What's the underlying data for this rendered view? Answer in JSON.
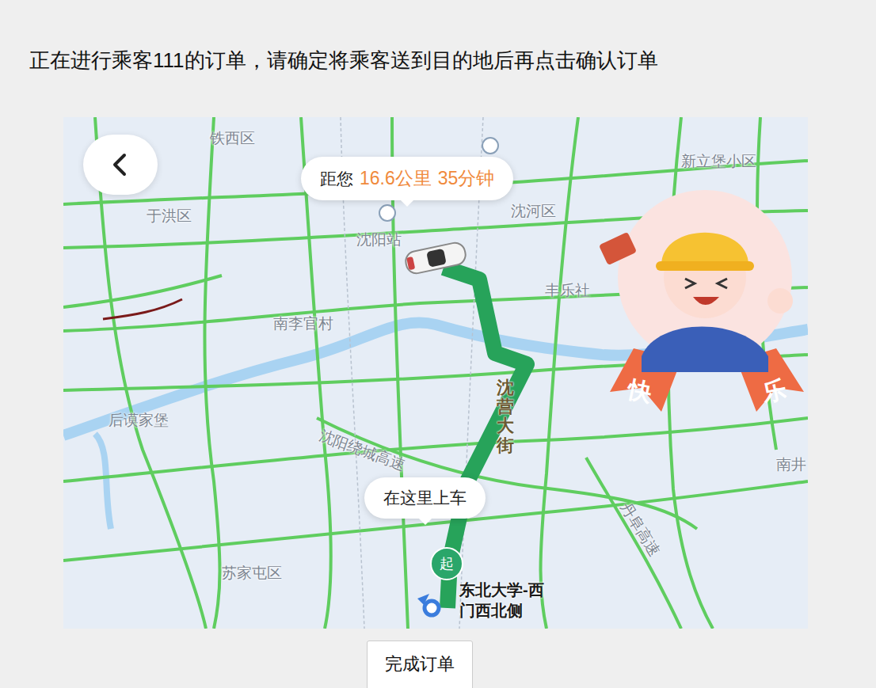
{
  "instruction": "正在进行乘客111的订单，请确定将乘客送到目的地后再点击确认订单",
  "map": {
    "distance_bubble": {
      "prefix": "距您",
      "distance": "16.6公里",
      "duration": "35分钟"
    },
    "labels": [
      {
        "text": "铁西区",
        "kind": "district"
      },
      {
        "text": "新立堡小区",
        "kind": "district"
      },
      {
        "text": "于洪区",
        "kind": "district"
      },
      {
        "text": "沈阳站",
        "kind": "station"
      },
      {
        "text": "沈河区",
        "kind": "district"
      },
      {
        "text": "丰乐社",
        "kind": "district"
      },
      {
        "text": "南李官村",
        "kind": "district"
      },
      {
        "text": "后谟家堡",
        "kind": "district"
      },
      {
        "text": "苏家屯区",
        "kind": "district"
      },
      {
        "text": "南井",
        "kind": "district"
      },
      {
        "text": "沈阳绕城高速",
        "kind": "road"
      },
      {
        "text": "丹阜高速",
        "kind": "road"
      },
      {
        "text": "沈营大街",
        "kind": "route"
      }
    ],
    "pickup_bubble": "在这里上车",
    "start_marker": "起",
    "destination": "东北大学-西门西北侧",
    "mascot_ribbon": [
      "快",
      "乐"
    ]
  },
  "buttons": [
    {
      "label": "完成订单"
    }
  ]
}
